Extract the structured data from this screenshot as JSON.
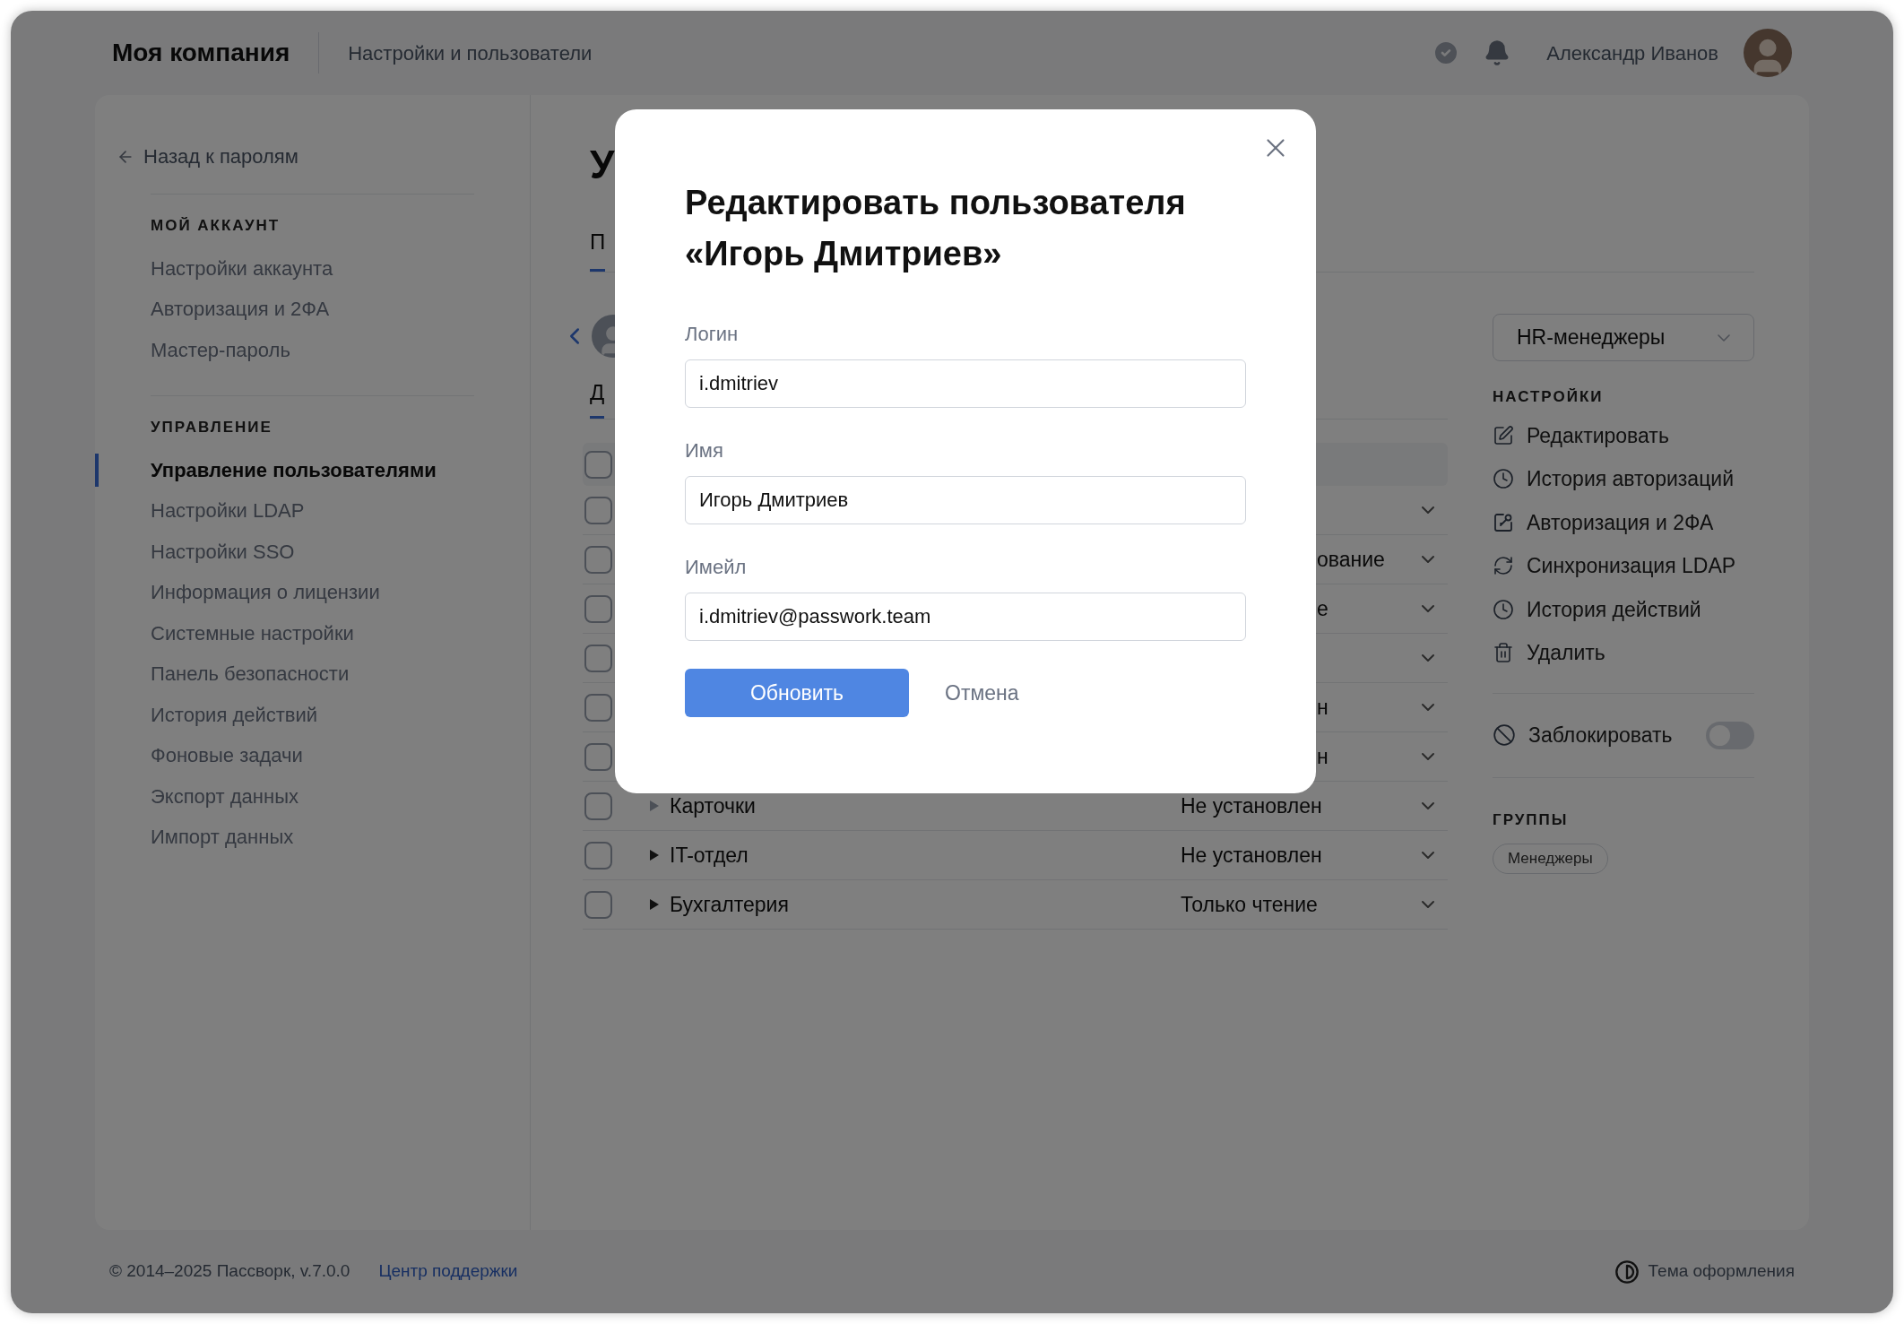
{
  "topbar": {
    "company": "Моя компания",
    "section": "Настройки и пользователи",
    "user": "Александр Иванов"
  },
  "sidebar": {
    "back": "Назад к паролям",
    "groups": [
      {
        "title": "МОЙ АККАУНТ",
        "items": [
          {
            "label": "Настройки аккаунта",
            "selected": false
          },
          {
            "label": "Авторизация и 2ФА",
            "selected": false
          },
          {
            "label": "Мастер-пароль",
            "selected": false
          }
        ]
      },
      {
        "title": "УПРАВЛЕНИЕ",
        "items": [
          {
            "label": "Управление пользователями",
            "selected": true
          },
          {
            "label": "Настройки LDAP",
            "selected": false
          },
          {
            "label": "Настройки SSO",
            "selected": false
          },
          {
            "label": "Информация о лицензии",
            "selected": false
          },
          {
            "label": "Системные настройки",
            "selected": false
          },
          {
            "label": "Панель безопасности",
            "selected": false
          },
          {
            "label": "История действий",
            "selected": false
          },
          {
            "label": "Фоновые задачи",
            "selected": false
          },
          {
            "label": "Экспорт данных",
            "selected": false
          },
          {
            "label": "Импорт данных",
            "selected": false
          }
        ]
      }
    ]
  },
  "content": {
    "heading": "У",
    "tab": "П",
    "subtab": "Д",
    "header_checked": false,
    "rows": [
      {
        "kind": "covered",
        "checked": false
      },
      {
        "kind": "covered",
        "access": "ование",
        "checked": false
      },
      {
        "kind": "covered",
        "access": "е",
        "checked": false
      },
      {
        "kind": "covered",
        "checked": false
      },
      {
        "kind": "covered",
        "access": "н",
        "checked": false
      },
      {
        "kind": "covered",
        "access": "н",
        "checked": false
      },
      {
        "kind": "full",
        "name": "Карточки",
        "access": "Не установлен",
        "has_children": false,
        "checked": false
      },
      {
        "kind": "full",
        "name": "IT-отдел",
        "access": "Не установлен",
        "has_children": true,
        "checked": false
      },
      {
        "kind": "full",
        "name": "Бухгалтерия",
        "access": "Только чтение",
        "has_children": true,
        "checked": false
      }
    ]
  },
  "panel": {
    "group_select": "HR-менеджеры",
    "settings_title": "НАСТРОЙКИ",
    "actions": [
      "Редактировать",
      "История авторизаций",
      "Авторизация и 2ФА",
      "Синхронизация LDAP",
      "История действий",
      "Удалить"
    ],
    "block": {
      "label": "Заблокировать",
      "on": false
    },
    "groups_title": "ГРУППЫ",
    "groups": [
      "Менеджеры"
    ]
  },
  "footer": {
    "copyright": "© 2014–2025 Пассворк, v.7.0.0",
    "support": "Центр поддержки",
    "theme": "Тема оформления"
  },
  "modal": {
    "title": "Редактировать пользователя «Игорь Дмитриев»",
    "fields": [
      {
        "label": "Логин",
        "value": "i.dmitriev"
      },
      {
        "label": "Имя",
        "value": "Игорь Дмитриев"
      },
      {
        "label": "Имейл",
        "value": "i.dmitriev@passwork.team"
      }
    ],
    "submit": "Обновить",
    "cancel": "Отмена"
  }
}
